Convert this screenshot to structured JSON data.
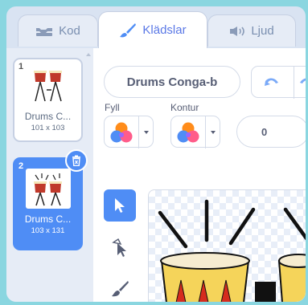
{
  "tabs": [
    {
      "label": "Kod",
      "icon": "code-icon",
      "active": false
    },
    {
      "label": "Klädslar",
      "icon": "paintbrush-icon",
      "active": true
    },
    {
      "label": "Ljud",
      "icon": "speaker-icon",
      "active": false
    }
  ],
  "costumes": [
    {
      "number": "1",
      "name": "Drums C...",
      "size": "101 x 103",
      "selected": false
    },
    {
      "number": "2",
      "name": "Drums C...",
      "size": "103 x 131",
      "selected": true
    }
  ],
  "editor": {
    "costume_name": "Drums Conga-b",
    "fill_label": "Fyll",
    "outline_label": "Kontur",
    "stroke_width": "0"
  },
  "colors": {
    "accent": "#4f8df5",
    "background": "#8ad6e0",
    "delete": "#4f8df5"
  },
  "tools": [
    "select-tool",
    "reshape-tool",
    "brush-tool"
  ]
}
